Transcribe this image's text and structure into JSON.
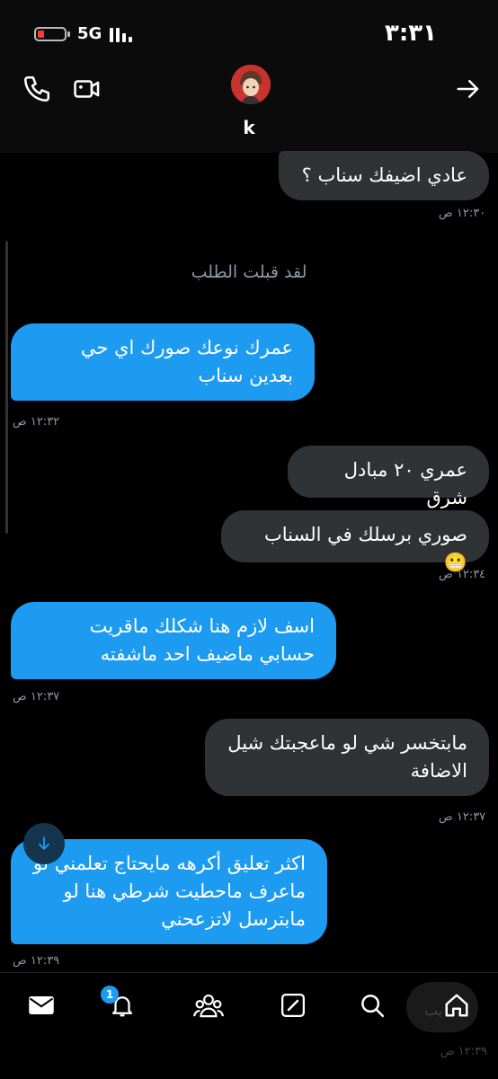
{
  "status_bar": {
    "network": "5G",
    "time": "٣:٣١"
  },
  "header": {
    "contact_name": "k"
  },
  "messages": [
    {
      "side": "received",
      "text": "عادي اضيفك سناب ؟",
      "time": "١٢:٣٠ ص"
    },
    {
      "side": "system",
      "text": "لقد قبلت الطلب"
    },
    {
      "side": "sent",
      "text": "عمرك نوعك صورك اي حي بعدين سناب",
      "time": "١٢:٣٢ ص"
    },
    {
      "side": "received",
      "text": "عمري ٢٠ مبادل شرق"
    },
    {
      "side": "received",
      "text": "صوري برسلك في السناب 😬",
      "time": "١٢:٣٤ ص"
    },
    {
      "side": "sent",
      "text": "اسف لازم هنا شكلك ماقريت حسابي ماضيف احد ماشفته",
      "time": "١٢:٣٧ ص"
    },
    {
      "side": "received",
      "text": "مابتخسر شي لو ماعجبتك شيل الاضافة",
      "time": "١٢:٣٧ ص"
    },
    {
      "side": "sent",
      "text": "اكثر تعليق أكرهه مايحتاج تعلمني لو ماعرف ماحطيت شرطي هنا لو مابترسل لاتزعحني",
      "time": "١٢:٣٩ ص"
    }
  ],
  "nav": {
    "items": [
      "mail-icon",
      "notifications-icon",
      "communities-icon",
      "compose-icon",
      "search-icon",
      "home-icon"
    ],
    "notification_count": "1"
  },
  "ghost": {
    "label": "يب",
    "time": "١٢:٣٩ ص"
  },
  "colors": {
    "sent_bubble": "#1d9bf0",
    "received_bubble": "#2f3336",
    "background": "#000000"
  }
}
